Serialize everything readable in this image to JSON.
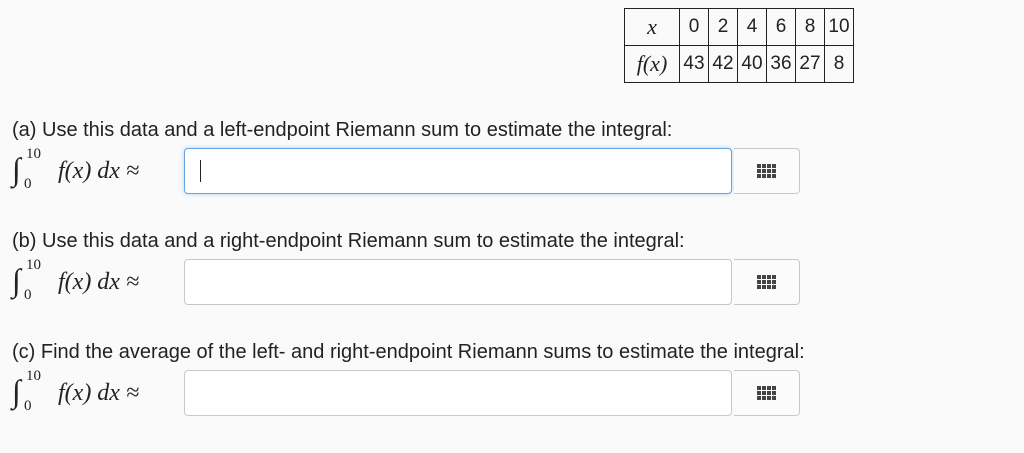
{
  "table": {
    "x_label": "x",
    "fx_label": "f(x)",
    "x_values": [
      "0",
      "2",
      "4",
      "6",
      "8",
      "10"
    ],
    "fx_values": [
      "43",
      "42",
      "40",
      "36",
      "27",
      "8"
    ]
  },
  "integral": {
    "sign": "∫",
    "upper": "10",
    "lower": "0",
    "body": "f(x) dx ≈"
  },
  "parts": [
    {
      "prompt": "(a) Use this data and a left-endpoint Riemann sum to estimate the integral:",
      "value": "",
      "focused": true
    },
    {
      "prompt": "(b) Use this data and a right-endpoint Riemann sum to estimate the integral:",
      "value": "",
      "focused": false
    },
    {
      "prompt": "(c) Find the average of the left- and right-endpoint Riemann sums to estimate the integral:",
      "value": "",
      "focused": false
    }
  ],
  "icons": {
    "keypad": "keypad-icon"
  },
  "colors": {
    "focus_border": "#66a3e0",
    "input_border": "#c8c8c8"
  }
}
